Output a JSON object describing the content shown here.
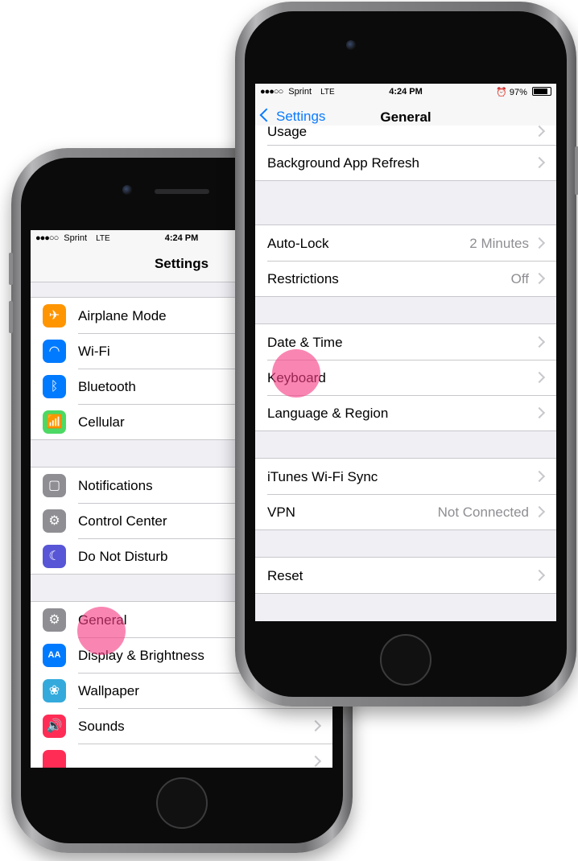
{
  "left_phone": {
    "status": {
      "signal": "●●●○○",
      "carrier": "Sprint",
      "network": "LTE",
      "time": "4:24 PM"
    },
    "nav_title": "Settings",
    "groups": [
      [
        {
          "label": "Airplane Mode",
          "icon": "airplane-icon",
          "glyph": "✈",
          "color": "#ff9500"
        },
        {
          "label": "Wi-Fi",
          "icon": "wifi-icon",
          "glyph": "◠",
          "color": "#007aff"
        },
        {
          "label": "Bluetooth",
          "icon": "bluetooth-icon",
          "glyph": "ᛒ",
          "color": "#007aff"
        },
        {
          "label": "Cellular",
          "icon": "cellular-icon",
          "glyph": "📶",
          "color": "#4cd964"
        }
      ],
      [
        {
          "label": "Notifications",
          "icon": "notifications-icon",
          "glyph": "▢",
          "color": "#8e8e93"
        },
        {
          "label": "Control Center",
          "icon": "control-center-icon",
          "glyph": "⚙",
          "color": "#8e8e93"
        },
        {
          "label": "Do Not Disturb",
          "icon": "moon-icon",
          "glyph": "☾",
          "color": "#5856d6"
        }
      ],
      [
        {
          "label": "General",
          "icon": "gear-icon",
          "glyph": "⚙",
          "color": "#8e8e93"
        },
        {
          "label": "Display & Brightness",
          "icon": "display-icon",
          "glyph": "AA",
          "color": "#007aff"
        },
        {
          "label": "Wallpaper",
          "icon": "wallpaper-icon",
          "glyph": "❀",
          "color": "#34aadc"
        },
        {
          "label": "Sounds",
          "icon": "sounds-icon",
          "glyph": "🔊",
          "color": "#ff2d55"
        },
        {
          "label": "",
          "icon": "touch-id-icon",
          "glyph": "",
          "color": "#ff2d55"
        }
      ]
    ]
  },
  "right_phone": {
    "status": {
      "signal": "●●●○○",
      "carrier": "Sprint",
      "network": "LTE",
      "time": "4:24 PM",
      "battery": "97%"
    },
    "back_label": "Settings",
    "nav_title": "General",
    "groups": [
      [
        {
          "label": "Usage",
          "value": ""
        },
        {
          "label": "Background App Refresh",
          "value": ""
        }
      ],
      [
        {
          "label": "Auto-Lock",
          "value": "2 Minutes"
        },
        {
          "label": "Restrictions",
          "value": "Off"
        }
      ],
      [
        {
          "label": "Date & Time",
          "value": ""
        },
        {
          "label": "Keyboard",
          "value": ""
        },
        {
          "label": "Language & Region",
          "value": ""
        }
      ],
      [
        {
          "label": "iTunes Wi-Fi Sync",
          "value": ""
        },
        {
          "label": "VPN",
          "value": "Not Connected"
        }
      ],
      [
        {
          "label": "Reset",
          "value": ""
        }
      ]
    ]
  },
  "colors": {
    "tap_highlight": "#f53c82",
    "ios_blue": "#0a7aff",
    "group_bg": "#efeff4"
  }
}
